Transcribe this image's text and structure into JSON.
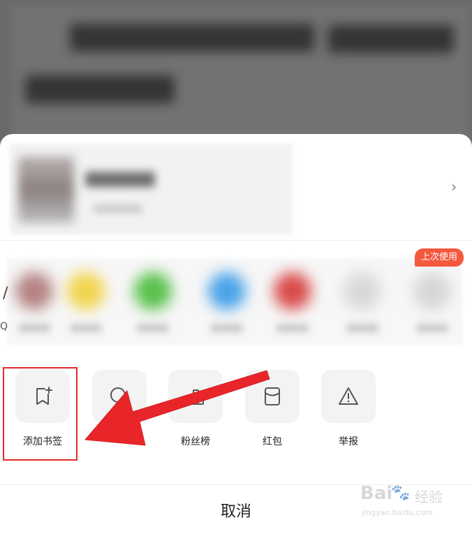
{
  "profile": {
    "chevron": "›"
  },
  "share": {
    "last_used_badge": "上次使用",
    "edge_glyph_a": "/",
    "edge_glyph_q": "Q",
    "items": [
      {
        "color": "#b58282"
      },
      {
        "color": "#f1d44e"
      },
      {
        "color": "#57c14a"
      },
      {
        "color": "#4aa3e8"
      },
      {
        "color": "#d94b4b"
      },
      {
        "color": "#d8d8d8"
      },
      {
        "color": "#d6d6d6"
      }
    ]
  },
  "actions": [
    {
      "label": "添加书签",
      "icon": "bookmark-add-icon"
    },
    {
      "label": "",
      "icon": "search-icon"
    },
    {
      "label": "粉丝榜",
      "icon": "fan-ranking-icon"
    },
    {
      "label": "红包",
      "icon": "red-packet-icon"
    },
    {
      "label": "举报",
      "icon": "report-warning-icon"
    }
  ],
  "cancel": {
    "label": "取消"
  },
  "watermark": {
    "brand": "Bai",
    "brand_cn": "经验",
    "url": "jingyan.baidu.com"
  },
  "colors": {
    "highlight": "#e32a2a",
    "badge": "#f4583d",
    "arrow": "#e8262a"
  }
}
